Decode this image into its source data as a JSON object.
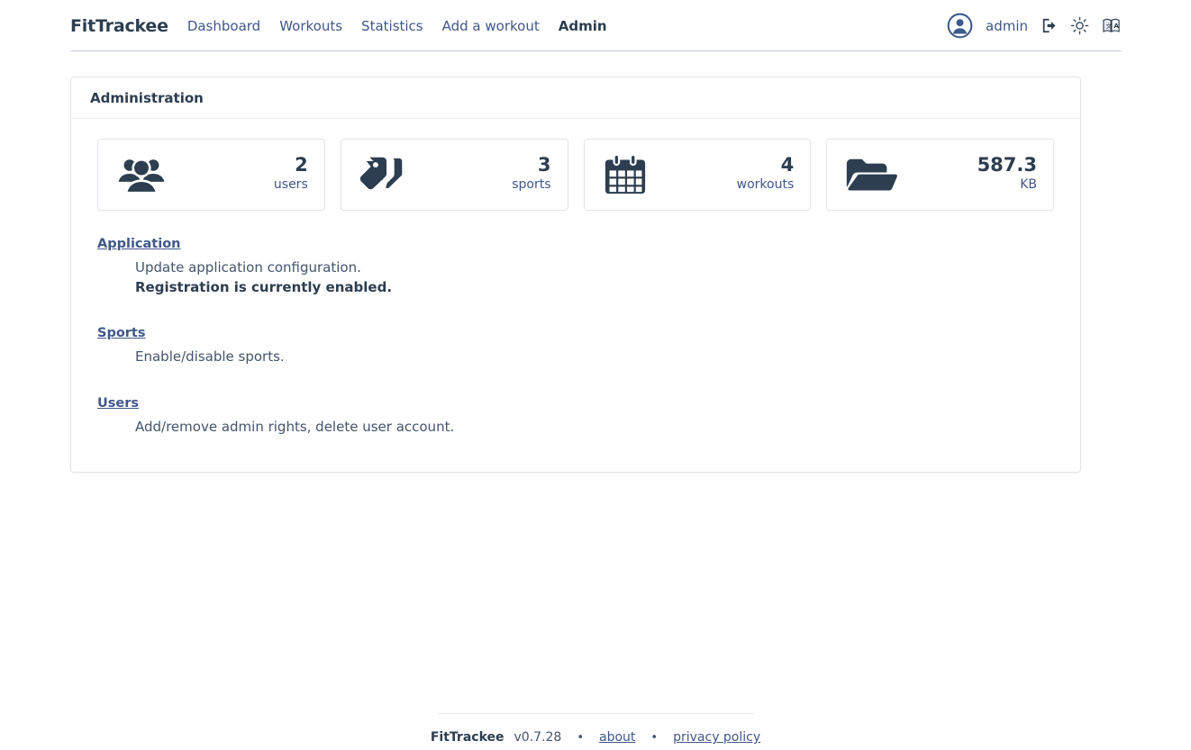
{
  "header": {
    "brand": "FitTrackee",
    "nav": [
      {
        "label": "Dashboard",
        "active": false
      },
      {
        "label": "Workouts",
        "active": false
      },
      {
        "label": "Statistics",
        "active": false
      },
      {
        "label": "Add a workout",
        "active": false
      },
      {
        "label": "Admin",
        "active": true
      }
    ],
    "username": "admin",
    "icons": {
      "avatar": "user-circle-icon",
      "logout": "sign-out-icon",
      "theme": "sun-icon",
      "language": "language-icon"
    }
  },
  "main": {
    "card_title": "Administration",
    "stats": [
      {
        "icon": "users-icon",
        "value": "2",
        "label": "users"
      },
      {
        "icon": "tags-icon",
        "value": "3",
        "label": "sports"
      },
      {
        "icon": "calendar-icon",
        "value": "4",
        "label": "workouts"
      },
      {
        "icon": "folder-open-icon",
        "value": "587.3",
        "label": "KB"
      }
    ],
    "sections": [
      {
        "link": "Application",
        "lines": [
          {
            "text": "Update application configuration.",
            "bold": false
          },
          {
            "text": "Registration is currently enabled.",
            "bold": true
          }
        ]
      },
      {
        "link": "Sports",
        "lines": [
          {
            "text": "Enable/disable sports.",
            "bold": false
          }
        ]
      },
      {
        "link": "Users",
        "lines": [
          {
            "text": "Add/remove admin rights, delete user account.",
            "bold": false
          }
        ]
      }
    ]
  },
  "footer": {
    "app": "FitTrackee",
    "version": "v0.7.28",
    "dot": "•",
    "about": "about",
    "privacy": "privacy policy"
  },
  "colors": {
    "accent": "#40578a",
    "text": "#2c3e50",
    "border": "#e1e4ea"
  }
}
